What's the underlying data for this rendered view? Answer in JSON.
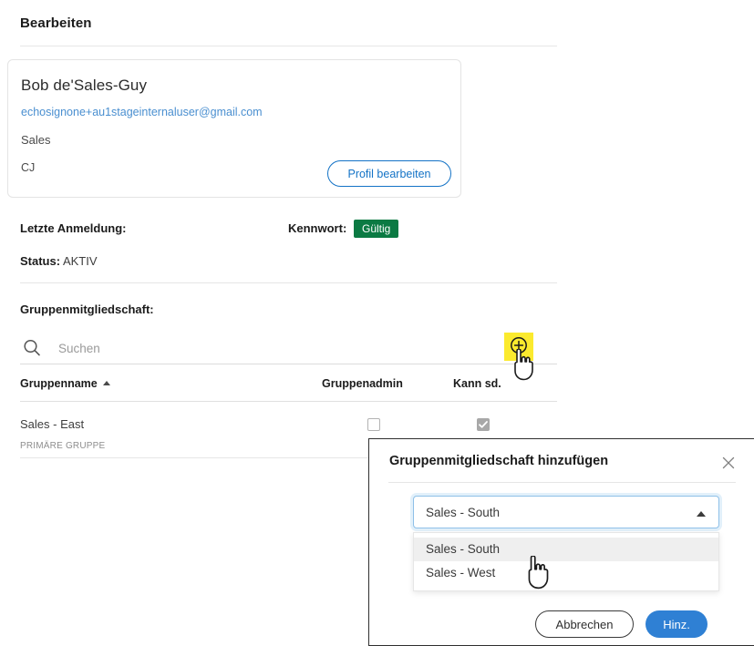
{
  "header": {
    "title": "Bearbeiten"
  },
  "profile": {
    "name": "Bob de'Sales-Guy",
    "email": "echosignone+au1stageinternaluser@gmail.com",
    "org": "Sales",
    "initials": "CJ",
    "edit_button": "Profil bearbeiten",
    "accent_color": "#1473c6"
  },
  "meta": {
    "last_login_label": "Letzte Anmeldung:",
    "last_login_value": "",
    "password_label": "Kennwort:",
    "password_badge": "Gültig",
    "password_badge_color": "#0b7a43",
    "status_label": "Status:",
    "status_value": "AKTIV"
  },
  "groups": {
    "heading": "Gruppenmitgliedschaft:",
    "search_placeholder": "Suchen",
    "search_value": "",
    "search_icon": "search-icon",
    "add_icon": "plus-circle-icon",
    "add_highlight_color": "#fbea2e",
    "columns": [
      "Gruppenname",
      "Gruppenadmin",
      "Kann sd."
    ],
    "sort_column": "Gruppenname",
    "sort_direction": "asc",
    "rows": [
      {
        "name": "Sales - East",
        "tag": "PRIMÄRE GRUPPE",
        "group_admin_checked": false,
        "can_see_checked": true
      }
    ]
  },
  "modal": {
    "title": "Gruppenmitgliedschaft hinzufügen",
    "close_icon": "close-icon",
    "select": {
      "value": "Sales - South",
      "caret_icon": "chevron-up-icon",
      "expanded": true,
      "options": [
        {
          "label": "Sales - South",
          "selected": true
        },
        {
          "label": "Sales - West",
          "selected": false
        }
      ]
    },
    "cancel_button": "Abbrechen",
    "add_button": "Hinz.",
    "add_button_color": "#2f80d4"
  }
}
